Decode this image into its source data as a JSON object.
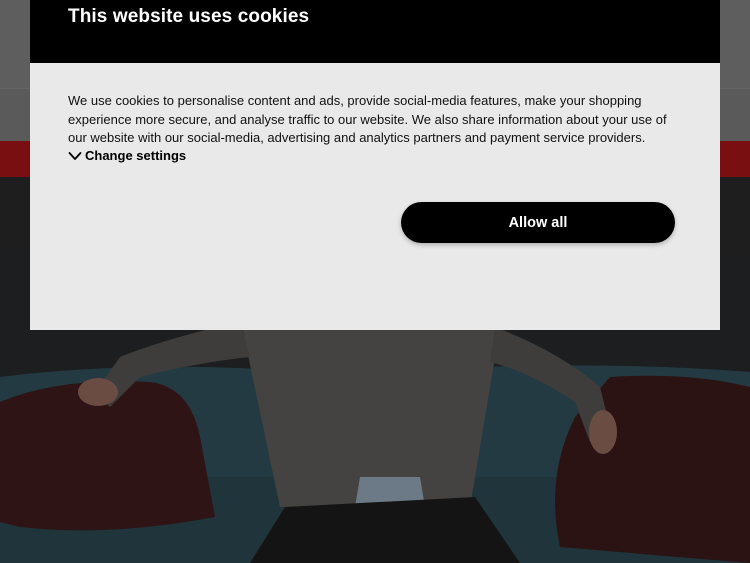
{
  "cookie_dialog": {
    "title": "This website uses cookies",
    "body_text": "We use cookies to personalise content and ads, provide social-media features, make your shopping experience more secure, and analyse traffic to our website. We also share information about your use of our website with our social-media, advertising and analytics partners and payment service providers.",
    "change_settings_label": "Change settings",
    "change_settings_icon": "chevron-down-icon",
    "allow_all_label": "Allow all"
  },
  "colors": {
    "dialog_header": "#000000",
    "dialog_body": "#e9e9e9",
    "button_bg": "#000000",
    "button_text": "#ffffff",
    "page_accent_bar": "#7a0f12"
  }
}
